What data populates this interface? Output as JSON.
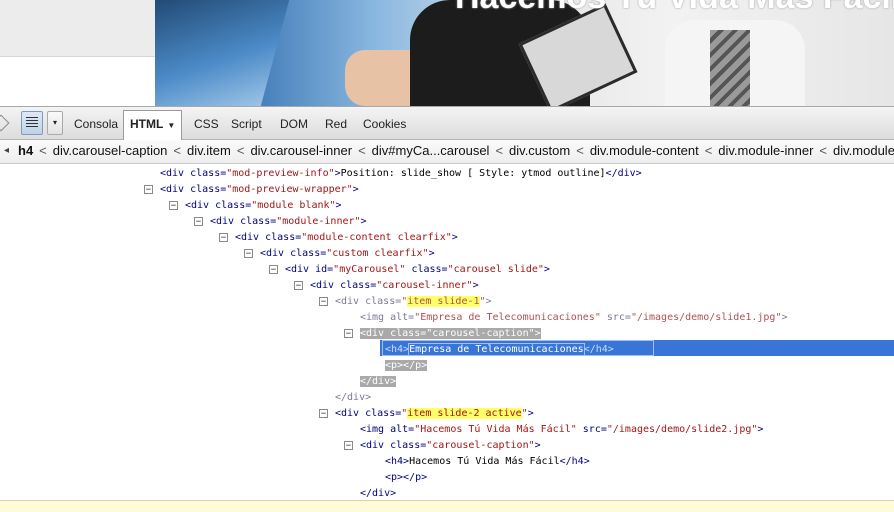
{
  "banner": {
    "heading": "Hacemos Tú Vida Más Fácil"
  },
  "toolbar": {
    "tabs": [
      "Consola",
      "HTML",
      "CSS",
      "Script",
      "DOM",
      "Red",
      "Cookies"
    ],
    "active_tab": "HTML"
  },
  "breadcrumb": [
    "h4",
    "div.carousel-caption",
    "div.item",
    "div.carousel-inner",
    "div#myCa...carousel",
    "div.custom",
    "div.module-content",
    "div.module-inner",
    "div.module"
  ],
  "tree": {
    "r0": {
      "tag": "div",
      "attr": "class",
      "val": "mod-preview-info",
      "text": "Position: slide_show [ Style: ytmod outline]"
    },
    "r1": {
      "tag": "div",
      "attr": "class",
      "val": "mod-preview-wrapper"
    },
    "r2": {
      "tag": "div",
      "attr": "class",
      "val": "module blank"
    },
    "r3": {
      "tag": "div",
      "attr": "class",
      "val": "module-inner"
    },
    "r4": {
      "tag": "div",
      "attr": "class",
      "val": "module-content clearfix"
    },
    "r5": {
      "tag": "div",
      "attr": "class",
      "val": "custom clearfix"
    },
    "r6": {
      "tag": "div",
      "attr1": "id",
      "val1": "myCarousel",
      "attr2": "class",
      "val2": "carousel slide"
    },
    "r7": {
      "tag": "div",
      "attr": "class",
      "val": "carousel-inner"
    },
    "r8": {
      "tag": "div",
      "attr": "class",
      "val": "item slide-1"
    },
    "r9": {
      "tag": "img",
      "attr1": "alt",
      "val1": "Empresa de Telecomunicaciones",
      "attr2": "src",
      "val2": "/images/demo/slide1.jpg"
    },
    "r10": {
      "tag": "div",
      "attr": "class",
      "val": "carousel-caption"
    },
    "r11": {
      "tag": "h4",
      "text": "Empresa de Telecomunicaciones"
    },
    "r12": {
      "tag": "p"
    },
    "r13": {
      "tag": "div"
    },
    "r14": {
      "tag": "div"
    },
    "r15": {
      "tag": "div",
      "attr": "class",
      "val": "item slide-2 active"
    },
    "r16": {
      "tag": "img",
      "attr1": "alt",
      "val1": "Hacemos Tú Vida Más Fácil",
      "attr2": "src",
      "val2": "/images/demo/slide2.jpg"
    },
    "r17": {
      "tag": "div",
      "attr": "class",
      "val": "carousel-caption"
    },
    "r18": {
      "tag": "h4",
      "text": "Hacemos Tú Vida Más Fácil"
    },
    "r19": {
      "tag": "p"
    },
    "r20": {
      "tag": "div"
    }
  },
  "colors": {
    "tag": "#000080",
    "attr_value": "#a31515",
    "selection": "#3875d7",
    "highlight": "#ffff66"
  }
}
